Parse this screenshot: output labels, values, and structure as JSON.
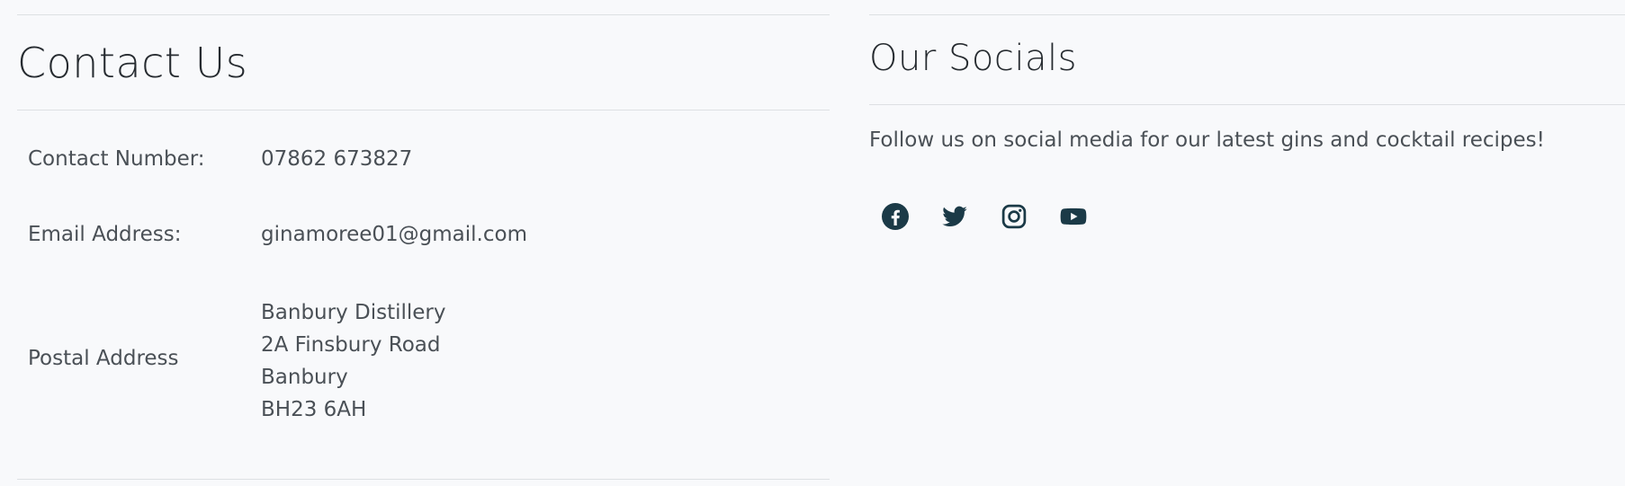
{
  "contact": {
    "title": "Contact Us",
    "rows": [
      {
        "label": "Contact Number:",
        "value": "07862 673827"
      },
      {
        "label": "Email Address:",
        "value": "ginamoree01@gmail.com"
      },
      {
        "label": "Postal Address",
        "address_lines": [
          "Banbury Distillery",
          "2A Finsbury Road",
          "Banbury",
          "BH23 6AH"
        ]
      }
    ]
  },
  "socials": {
    "title": "Our Socials",
    "description": "Follow us on social media for our latest gins and cocktail recipes!",
    "icons": [
      {
        "name": "facebook-icon"
      },
      {
        "name": "twitter-icon"
      },
      {
        "name": "instagram-icon"
      },
      {
        "name": "youtube-icon"
      }
    ]
  },
  "colors": {
    "background": "#f8f9fb",
    "divider": "#dde0e3",
    "icon": "#1b3a47",
    "text": "#4a5056",
    "heading": "#262b30"
  }
}
